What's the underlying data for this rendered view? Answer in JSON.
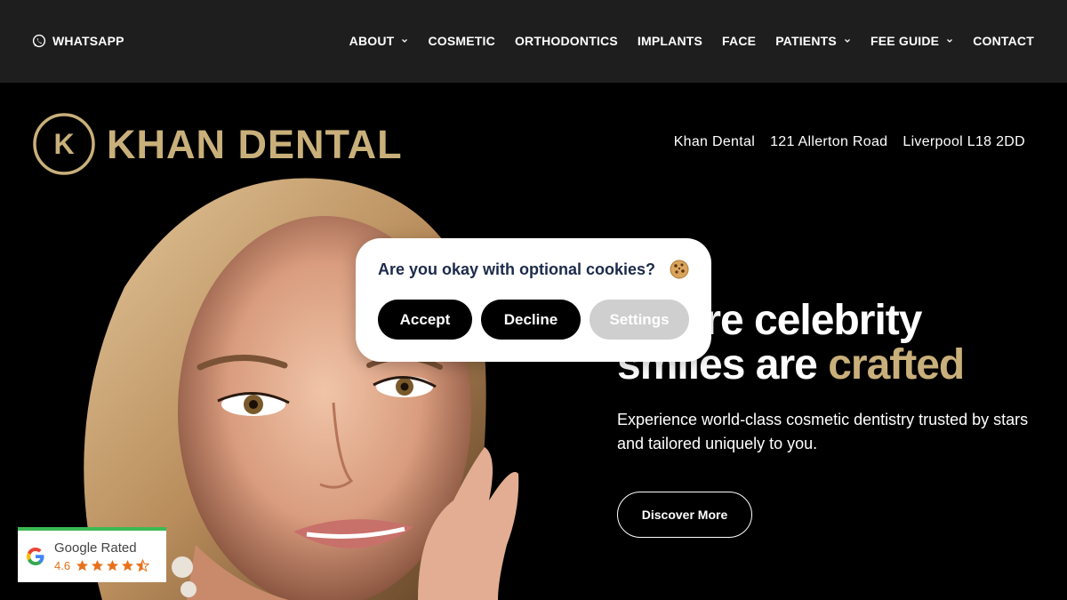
{
  "topbar": {
    "whatsapp_label": "WHATSAPP",
    "nav": [
      {
        "label": "ABOUT",
        "dropdown": true
      },
      {
        "label": "COSMETIC",
        "dropdown": false
      },
      {
        "label": "ORTHODONTICS",
        "dropdown": false
      },
      {
        "label": "IMPLANTS",
        "dropdown": false
      },
      {
        "label": "FACE",
        "dropdown": false
      },
      {
        "label": "PATIENTS",
        "dropdown": true
      },
      {
        "label": "FEE GUIDE",
        "dropdown": true
      },
      {
        "label": "CONTACT",
        "dropdown": false
      }
    ]
  },
  "brand": {
    "monogram": "K",
    "name": "KHAN DENTAL",
    "gold": "#c9b07a"
  },
  "address": {
    "practice": "Khan Dental",
    "street": "121 Allerton Road",
    "city": "Liverpool L18 2DD"
  },
  "hero": {
    "headline_line1": "Where celebrity",
    "headline_line2_white": "smiles are ",
    "headline_line2_gold": "crafted",
    "subtext": "Experience world-class cosmetic dentistry trusted by stars and tailored uniquely to you.",
    "cta_label": "Discover More"
  },
  "google_badge": {
    "title": "Google Rated",
    "score": "4.6",
    "rating": 4.6,
    "stars_max": 5
  },
  "cookie_popup": {
    "question": "Are you okay with optional cookies?",
    "icon": "cookie-icon",
    "accept_label": "Accept",
    "decline_label": "Decline",
    "settings_label": "Settings"
  }
}
